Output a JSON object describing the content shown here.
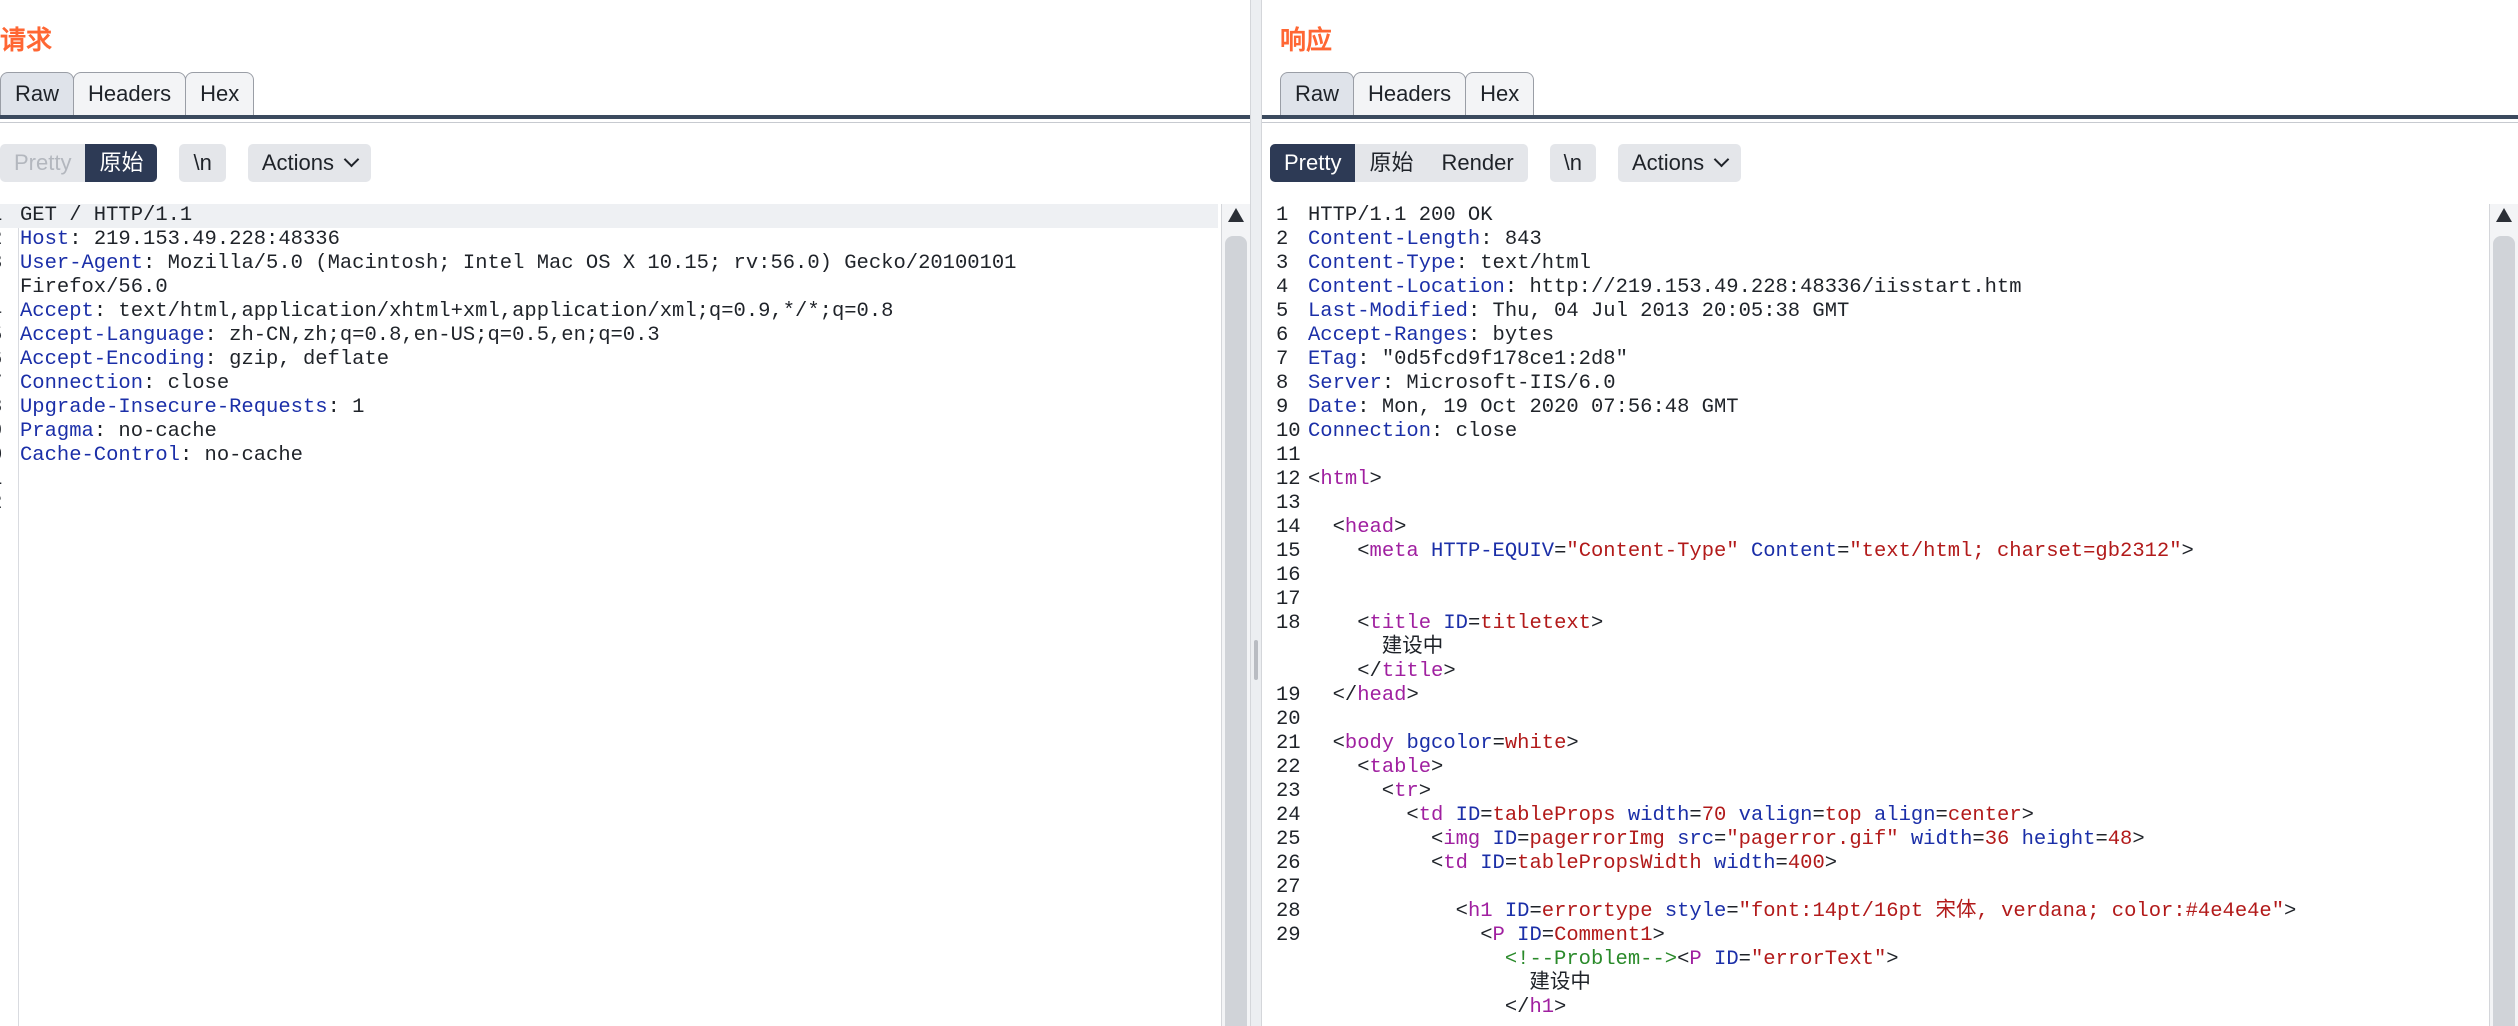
{
  "request": {
    "title": "请求",
    "tabs": [
      "Raw",
      "Headers",
      "Hex"
    ],
    "view_options": [
      "Pretty",
      "原始"
    ],
    "newline_label": "\\n",
    "actions_label": "Actions",
    "lines": [
      {
        "n": "1",
        "text": "GET / HTTP/1.1"
      },
      {
        "n": "2",
        "key": "Host",
        "value": " 219.153.49.228:48336"
      },
      {
        "n": "3",
        "key": "User-Agent",
        "value": " Mozilla/5.0 (Macintosh; Intel Mac OS X 10.15; rv:56.0) Gecko/20100101"
      },
      {
        "n": "",
        "text": "Firefox/56.0"
      },
      {
        "n": "4",
        "key": "Accept",
        "value": " text/html,application/xhtml+xml,application/xml;q=0.9,*/*;q=0.8"
      },
      {
        "n": "5",
        "key": "Accept-Language",
        "value": " zh-CN,zh;q=0.8,en-US;q=0.5,en;q=0.3"
      },
      {
        "n": "6",
        "key": "Accept-Encoding",
        "value": " gzip, deflate"
      },
      {
        "n": "7",
        "key": "Connection",
        "value": " close"
      },
      {
        "n": "8",
        "key": "Upgrade-Insecure-Requests",
        "value": " 1"
      },
      {
        "n": "9",
        "key": "Pragma",
        "value": " no-cache"
      },
      {
        "n": "0",
        "key": "Cache-Control",
        "value": " no-cache"
      },
      {
        "n": "1",
        "text": ""
      },
      {
        "n": "2",
        "text": ""
      }
    ]
  },
  "response": {
    "title": "响应",
    "tabs": [
      "Raw",
      "Headers",
      "Hex"
    ],
    "view_options": [
      "Pretty",
      "原始",
      "Render"
    ],
    "newline_label": "\\n",
    "actions_label": "Actions",
    "lines": [
      {
        "n": "1",
        "text": "HTTP/1.1 200 OK"
      },
      {
        "n": "2",
        "key": "Content-Length",
        "value": " 843"
      },
      {
        "n": "3",
        "key": "Content-Type",
        "value": " text/html"
      },
      {
        "n": "4",
        "key": "Content-Location",
        "value": " http://219.153.49.228:48336/iisstart.htm"
      },
      {
        "n": "5",
        "key": "Last-Modified",
        "value": " Thu, 04 Jul 2013 20:05:38 GMT"
      },
      {
        "n": "6",
        "key": "Accept-Ranges",
        "value": " bytes"
      },
      {
        "n": "7",
        "key": "ETag",
        "value": " \"0d5fcd9f178ce1:2d8\""
      },
      {
        "n": "8",
        "key": "Server",
        "value": " Microsoft-IIS/6.0"
      },
      {
        "n": "9",
        "key": "Date",
        "value": " Mon, 19 Oct 2020 07:56:48 GMT"
      },
      {
        "n": "10",
        "key": "Connection",
        "value": " close"
      },
      {
        "n": "11",
        "text": ""
      },
      {
        "n": "12",
        "html": [
          [
            "t",
            "<"
          ],
          [
            "tag",
            "html"
          ],
          [
            "t",
            ">"
          ]
        ]
      },
      {
        "n": "13",
        "text": ""
      },
      {
        "n": "14",
        "html": [
          [
            "t",
            "  <"
          ],
          [
            "tag",
            "head"
          ],
          [
            "t",
            ">"
          ]
        ]
      },
      {
        "n": "15",
        "html": [
          [
            "t",
            "    <"
          ],
          [
            "tag",
            "meta"
          ],
          [
            "t",
            " "
          ],
          [
            "attr",
            "HTTP-EQUIV"
          ],
          [
            "t",
            "="
          ],
          [
            "str",
            "\"Content-Type\""
          ],
          [
            "t",
            " "
          ],
          [
            "attr",
            "Content"
          ],
          [
            "t",
            "="
          ],
          [
            "str",
            "\"text/html; charset=gb2312\""
          ],
          [
            "t",
            ">"
          ]
        ]
      },
      {
        "n": "16",
        "text": ""
      },
      {
        "n": "17",
        "text": ""
      },
      {
        "n": "18",
        "html": [
          [
            "t",
            "    <"
          ],
          [
            "tag",
            "title"
          ],
          [
            "t",
            " "
          ],
          [
            "attr",
            "ID"
          ],
          [
            "t",
            "="
          ],
          [
            "str",
            "titletext"
          ],
          [
            "t",
            ">"
          ]
        ]
      },
      {
        "n": "",
        "html": [
          [
            "t",
            "      建设中"
          ]
        ]
      },
      {
        "n": "",
        "html": [
          [
            "t",
            "    </"
          ],
          [
            "tag",
            "title"
          ],
          [
            "t",
            ">"
          ]
        ]
      },
      {
        "n": "19",
        "html": [
          [
            "t",
            "  </"
          ],
          [
            "tag",
            "head"
          ],
          [
            "t",
            ">"
          ]
        ]
      },
      {
        "n": "20",
        "text": ""
      },
      {
        "n": "21",
        "html": [
          [
            "t",
            "  <"
          ],
          [
            "tag",
            "body"
          ],
          [
            "t",
            " "
          ],
          [
            "attr",
            "bgcolor"
          ],
          [
            "t",
            "="
          ],
          [
            "str",
            "white"
          ],
          [
            "t",
            ">"
          ]
        ]
      },
      {
        "n": "22",
        "html": [
          [
            "t",
            "    <"
          ],
          [
            "tag",
            "table"
          ],
          [
            "t",
            ">"
          ]
        ]
      },
      {
        "n": "23",
        "html": [
          [
            "t",
            "      <"
          ],
          [
            "tag",
            "tr"
          ],
          [
            "t",
            ">"
          ]
        ]
      },
      {
        "n": "24",
        "html": [
          [
            "t",
            "        <"
          ],
          [
            "tag",
            "td"
          ],
          [
            "t",
            " "
          ],
          [
            "attr",
            "ID"
          ],
          [
            "t",
            "="
          ],
          [
            "str",
            "tableProps"
          ],
          [
            "t",
            " "
          ],
          [
            "attr",
            "width"
          ],
          [
            "t",
            "="
          ],
          [
            "str",
            "70"
          ],
          [
            "t",
            " "
          ],
          [
            "attr",
            "valign"
          ],
          [
            "t",
            "="
          ],
          [
            "str",
            "top"
          ],
          [
            "t",
            " "
          ],
          [
            "attr",
            "align"
          ],
          [
            "t",
            "="
          ],
          [
            "str",
            "center"
          ],
          [
            "t",
            ">"
          ]
        ]
      },
      {
        "n": "25",
        "html": [
          [
            "t",
            "          <"
          ],
          [
            "tag",
            "img"
          ],
          [
            "t",
            " "
          ],
          [
            "attr",
            "ID"
          ],
          [
            "t",
            "="
          ],
          [
            "str",
            "pagerrorImg"
          ],
          [
            "t",
            " "
          ],
          [
            "attr",
            "src"
          ],
          [
            "t",
            "="
          ],
          [
            "str",
            "\"pagerror.gif\""
          ],
          [
            "t",
            " "
          ],
          [
            "attr",
            "width"
          ],
          [
            "t",
            "="
          ],
          [
            "str",
            "36"
          ],
          [
            "t",
            " "
          ],
          [
            "attr",
            "height"
          ],
          [
            "t",
            "="
          ],
          [
            "str",
            "48"
          ],
          [
            "t",
            ">"
          ]
        ]
      },
      {
        "n": "26",
        "html": [
          [
            "t",
            "          <"
          ],
          [
            "tag",
            "td"
          ],
          [
            "t",
            " "
          ],
          [
            "attr",
            "ID"
          ],
          [
            "t",
            "="
          ],
          [
            "str",
            "tablePropsWidth"
          ],
          [
            "t",
            " "
          ],
          [
            "attr",
            "width"
          ],
          [
            "t",
            "="
          ],
          [
            "str",
            "400"
          ],
          [
            "t",
            ">"
          ]
        ]
      },
      {
        "n": "27",
        "text": ""
      },
      {
        "n": "28",
        "html": [
          [
            "t",
            "            <"
          ],
          [
            "tag",
            "h1"
          ],
          [
            "t",
            " "
          ],
          [
            "attr",
            "ID"
          ],
          [
            "t",
            "="
          ],
          [
            "str",
            "errortype"
          ],
          [
            "t",
            " "
          ],
          [
            "attr",
            "style"
          ],
          [
            "t",
            "="
          ],
          [
            "str",
            "\"font:14pt/16pt 宋体, verdana; color:#4e4e4e\""
          ],
          [
            "t",
            ">"
          ]
        ]
      },
      {
        "n": "29",
        "html": [
          [
            "t",
            "              <"
          ],
          [
            "tag",
            "P"
          ],
          [
            "t",
            " "
          ],
          [
            "attr",
            "ID"
          ],
          [
            "t",
            "="
          ],
          [
            "str",
            "Comment1"
          ],
          [
            "t",
            ">"
          ]
        ]
      },
      {
        "n": "",
        "html": [
          [
            "t",
            "                "
          ],
          [
            "cmt",
            "<!--Problem-->"
          ],
          [
            "t",
            "<"
          ],
          [
            "tag",
            "P"
          ],
          [
            "t",
            " "
          ],
          [
            "attr",
            "ID"
          ],
          [
            "t",
            "="
          ],
          [
            "str",
            "\"errorText\""
          ],
          [
            "t",
            ">"
          ]
        ]
      },
      {
        "n": "",
        "html": [
          [
            "t",
            "                  建设中"
          ]
        ]
      },
      {
        "n": "",
        "html": [
          [
            "t",
            "                </"
          ],
          [
            "tag",
            "h1"
          ],
          [
            "t",
            ">"
          ]
        ]
      }
    ]
  },
  "layout_switch": [
    "columns",
    "rows",
    "single"
  ]
}
